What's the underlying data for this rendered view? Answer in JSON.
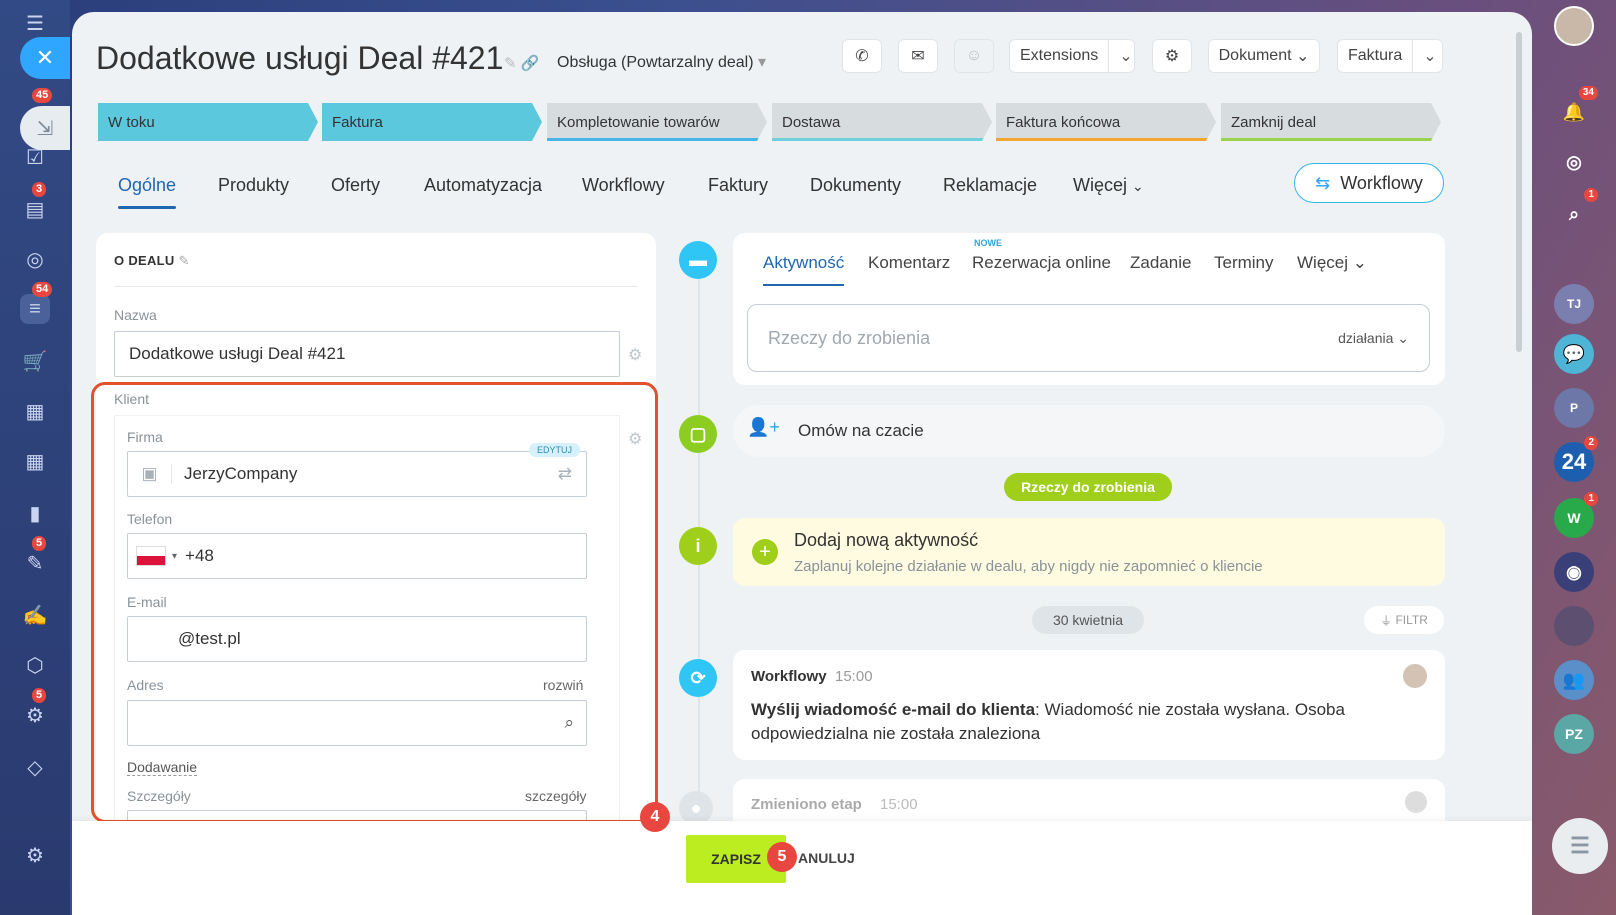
{
  "deal": {
    "title": "Dodatkowe usługi Deal #421",
    "pipeline": "Obsługa (Powtarzalny deal)"
  },
  "toolbar": {
    "extensions": "Extensions",
    "dokument": "Dokument",
    "faktura": "Faktura"
  },
  "stages": [
    {
      "label": "W toku",
      "color": "#5bc8de"
    },
    {
      "label": "Faktura",
      "color": "#5bc8de"
    },
    {
      "label": "Kompletowanie towarów",
      "color": "#d7dcdf",
      "accent": "#47b6e6"
    },
    {
      "label": "Dostawa",
      "color": "#d7dcdf",
      "accent": "#6ed0dc"
    },
    {
      "label": "Faktura końcowa",
      "color": "#d7dcdf",
      "accent": "#f3a531"
    },
    {
      "label": "Zamknij deal",
      "color": "#d7dcdf",
      "accent": "#9bd24c"
    }
  ],
  "tabs": [
    "Ogólne",
    "Produkty",
    "Oferty",
    "Automatyzacja",
    "Workflowy",
    "Faktury",
    "Dokumenty",
    "Reklamacje",
    "Więcej"
  ],
  "workflow_button": "Workflowy",
  "about": {
    "section_title": "O DEALU",
    "name_label": "Nazwa",
    "name_value": "Dodatkowe usługi Deal #421",
    "client_label": "Klient",
    "firm_label": "Firma",
    "edit_badge": "EDYTUJ",
    "firm_value": "JerzyCompany",
    "phone_label": "Telefon",
    "phone_value": "+48",
    "email_label": "E-mail",
    "email_value": "@test.pl",
    "address_label": "Adres",
    "address_expand": "rozwiń",
    "adding_label": "Dodawanie",
    "details_label": "Szczegóły",
    "details_link": "szczegóły"
  },
  "activity": {
    "tabs": [
      "Aktywność",
      "Komentarz",
      "Rezerwacja online",
      "Zadanie",
      "Terminy",
      "Więcej"
    ],
    "new_badge": "NOWE",
    "todo_placeholder": "Rzeczy do zrobienia",
    "actions": "działania",
    "chat": "Omów na czacie",
    "todo_pill": "Rzeczy do zrobienia",
    "add_title": "Dodaj nową aktywność",
    "add_sub": "Zaplanuj kolejne działanie w dealu, aby nigdy nie zapomnieć o kliencie",
    "date_pill": "30 kwietnia",
    "filter": "FILTR",
    "wf_title": "Workflowy",
    "wf_time": "15:00",
    "wf_bold": "Wyślij wiadomość e-mail do klienta",
    "wf_text": ": Wiadomość nie została wysłana. Osoba odpowiedzialna nie została znaleziona",
    "stage_title": "Zmieniono etap",
    "stage_time": "15:00"
  },
  "footer": {
    "save": "ZAPISZ",
    "cancel": "ANULUJ",
    "step4": "4",
    "step5": "5"
  },
  "left_badges": [
    "45",
    "3",
    "54",
    "5",
    "5"
  ],
  "right_badges": [
    "34",
    "1",
    "2",
    "1"
  ],
  "right_labels": {
    "b24": "24",
    "w": "W",
    "pz": "PZ",
    "p": "P",
    "tj": "TJ"
  }
}
